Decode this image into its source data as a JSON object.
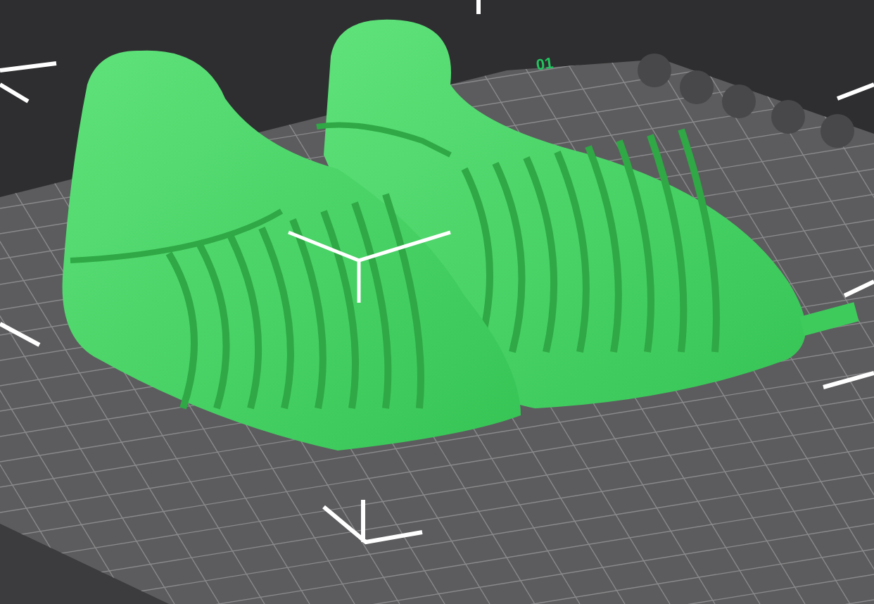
{
  "viewport": {
    "plate_label": "01"
  }
}
